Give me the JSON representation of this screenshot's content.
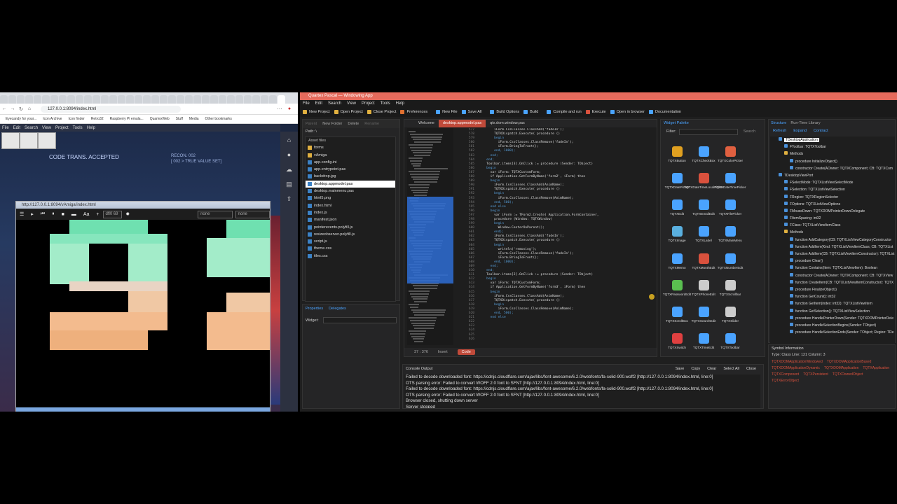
{
  "browser": {
    "tabs": [
      "",
      "",
      "",
      "",
      "",
      "",
      "",
      "",
      "",
      "",
      "",
      "",
      "",
      "",
      "",
      "",
      "",
      "",
      "",
      "",
      "",
      "",
      "",
      "",
      "",
      "",
      "",
      "",
      "",
      "",
      "",
      "",
      "",
      ""
    ],
    "url": "127.0.0.1:8094/index.html",
    "bookmarks": [
      "Eyecandy for your...",
      "Icon Archive",
      "Icon finder",
      "Retro32",
      "Raspberry Pi emula...",
      "QuartexWeb",
      "Stuff",
      "Media",
      "Other bookmarks"
    ],
    "app_menu": [
      "File",
      "Edit",
      "Search",
      "View",
      "Project",
      "Tools",
      "Help"
    ],
    "desktop_text": {
      "code_trans": "CODE TRANS. ACCEPTED",
      "recon": "RECON. 002",
      "true_value": "[ 002 > TRUE VALUE SET]"
    },
    "popup": {
      "title": "http://127.0.0.1:8094/vAmiga/index.html",
      "font_label": "Aa",
      "plus": "+",
      "dropdown_value": "dfl0 69",
      "input1_placeholder": "none",
      "input2_placeholder": "none"
    }
  },
  "ide": {
    "title": "Quartex Pascal — Windowing App",
    "menu": [
      "File",
      "Edit",
      "Search",
      "View",
      "Project",
      "Tools",
      "Help"
    ],
    "toolbar": [
      "New Project",
      "Open Project",
      "Close Project",
      "Preferences",
      "New File",
      "Save All",
      "Build Options",
      "Build",
      "Compile and run",
      "Execute",
      "Open in browser",
      "Documentation"
    ],
    "files_toolbar": [
      "Parent",
      "New Folder",
      "Delete",
      "Rename"
    ],
    "path": "Path: \\",
    "assets_header": "Asset files",
    "assets": [
      {
        "name": "forms",
        "type": "folder"
      },
      {
        "name": "vAmiga",
        "type": "folder"
      },
      {
        "name": "app.config.ini",
        "type": "file"
      },
      {
        "name": "app.entrypoint.pas",
        "type": "file"
      },
      {
        "name": "backdrop.jpg",
        "type": "file"
      },
      {
        "name": "desktop.appmodel.pas",
        "type": "file",
        "selected": true
      },
      {
        "name": "desktop.mainmenu.pas",
        "type": "file"
      },
      {
        "name": "html5.png",
        "type": "file"
      },
      {
        "name": "index.html",
        "type": "file"
      },
      {
        "name": "index.js",
        "type": "file"
      },
      {
        "name": "manifest.json",
        "type": "file"
      },
      {
        "name": "pointerevents.polyfill.js",
        "type": "file"
      },
      {
        "name": "resizeobserver.polyfill.js",
        "type": "file"
      },
      {
        "name": "script.js",
        "type": "file"
      },
      {
        "name": "theme.css",
        "type": "file"
      },
      {
        "name": "tiles.css",
        "type": "file"
      }
    ],
    "props_tabs": [
      "Properties",
      "Delegates"
    ],
    "widget_label": "Widget:",
    "editor_tabs": [
      "Welcome",
      "desktop.appmodel.pas",
      "qtx.dom.window.pas"
    ],
    "line_numbers": [
      "577",
      "578",
      "579",
      "580",
      "581",
      "582",
      "583",
      "584",
      "585",
      "586",
      "587",
      "588",
      "589",
      "590",
      "591",
      "592",
      "593",
      "594",
      "595",
      "596",
      "597",
      "598",
      "599",
      "600",
      "601",
      "602",
      "603",
      "604",
      "605",
      "606",
      "607",
      "608",
      "609",
      "610",
      "611",
      "612",
      "613",
      "614",
      "615",
      "616",
      "617",
      "618",
      "619",
      "620",
      "621",
      "622",
      "623",
      "624",
      "625",
      "626"
    ],
    "code_lines": [
      "        iForm.CssClasses.ClassAdd('fadeIn');",
      "        TQTXDispatch.Execute( procedure ()",
      "        begin",
      "          iForm.CssClasses.ClassRemove('fadeIn');",
      "          iForm.BringToFront();",
      "        end, 1000);",
      "",
      "      end;",
      "    end;",
      "",
      "    Toolbar.items[3].OnClick := procedure (Sender: TObject)",
      "    begin",
      "      var iForm: TQTXCustomForm;",
      "      if Application.GetFormByName('form2', iForm) then",
      "      begin",
      "        iForm.CssClasses.ClassAdd(AnimName);",
      "        TQTXDispatch.Execute( procedure ()",
      "        begin",
      "          iForm.CssClasses.ClassRemove(AnimName);",
      "        end, 500);",
      "      end else",
      "      begin",
      "        var iForm := TForm2.Create( Application.FormContainer,",
      "        procedure (Window: TQTXWindow)",
      "        begin",
      "          Window.CenterOnParent();",
      "        end);",
      "",
      "        iForm.CssClasses.ClassAdd('fadeIn');",
      "        TQTXDispatch.Execute( procedure ()",
      "        begin",
      "          writeln('removing');",
      "          iForm.CssClasses.ClassRemove('fadeIn');",
      "          iForm.BringToFront();",
      "        end, 1000);",
      "      end;",
      "    end;",
      "",
      "    Toolbar.items[2].OnClick := procedure (Sender: TObject)",
      "    begin",
      "      var iForm: TQTXCustomForm;",
      "      if Application.GetFormByName('form3', iForm) then",
      "      begin",
      "        iForm.CssClasses.ClassAdd(AnimName);",
      "        TQTXDispatch.Execute( procedure ()",
      "        begin",
      "          iForm.CssClasses.ClassRemove(AnimName);",
      "        end, 500);",
      "      end else"
    ],
    "editor_status": {
      "position": "37 : 376",
      "mode": "Insert",
      "code_label": "Code"
    },
    "palette": {
      "title": "Widget Palette",
      "filter_label": "Filter:",
      "search_label": "Search",
      "widgets": [
        "TQTXButton",
        "TQTXCheckBox",
        "TQTXColorPicker",
        "TQTXDatePicker",
        "TQTXDateTimeLocalPicker",
        "TQTXDateTimePicker",
        "TQTXEdit",
        "TQTXEmailEdit",
        "TQTXFilePicker",
        "TQTXImage",
        "TQTXLabel",
        "TQTXMainMenu",
        "TQTXMemo",
        "TQTXMonthEdit",
        "TQTXNumberEdit",
        "TQTXPasswordEdit",
        "TQTXPhoneEdit",
        "TQTXScrollbar",
        "TQTXScrollBox",
        "TQTXSearchEdit",
        "TQTXSlider",
        "TQTXSwitch",
        "TQTXTimeEdit",
        "TQTXToolbar"
      ]
    },
    "structure": {
      "tabs": [
        "Structure",
        "Run-Time Library"
      ],
      "tools": [
        "Refresh",
        "Expand",
        "Contract"
      ],
      "tree": [
        {
          "label": "TDesktopApplication",
          "level": 1,
          "color": "#4a90d9"
        },
        {
          "label": "FToolbar: TQTXToolbar",
          "level": 2,
          "color": "#4a90d9"
        },
        {
          "label": "Methods",
          "level": 2,
          "color": "#e0b040"
        },
        {
          "label": "procedure InitializeObject()",
          "level": 3,
          "color": "#4a90d9"
        },
        {
          "label": "constructor Create(AOwner: TQTXComponent; CB: TQTXCom",
          "level": 3,
          "color": "#4a90d9"
        },
        {
          "label": "TDesktopViewPort",
          "level": 1,
          "color": "#4a90d9"
        },
        {
          "label": "FSelectMode: TQTXListViewSelectMode",
          "level": 2,
          "color": "#4a90d9"
        },
        {
          "label": "FSelection: TQTXListViewSelection",
          "level": 2,
          "color": "#4a90d9"
        },
        {
          "label": "FRegion: TQTXRegionSelector",
          "level": 2,
          "color": "#4a90d9"
        },
        {
          "label": "FOptions: TQTXListViewOptions",
          "level": 2,
          "color": "#4a90d9"
        },
        {
          "label": "FMouseDown: TQTXDOMPointerDownDelegate",
          "level": 2,
          "color": "#4a90d9"
        },
        {
          "label": "FItemSpacing: int32",
          "level": 2,
          "color": "#4a90d9"
        },
        {
          "label": "FClass: TQTXListViewItemClass",
          "level": 2,
          "color": "#4a90d9"
        },
        {
          "label": "Methods",
          "level": 2,
          "color": "#e0b040"
        },
        {
          "label": "function AddCategory(CB: TQTXListViewCategoryConstructor",
          "level": 3,
          "color": "#4a90d9"
        },
        {
          "label": "function AddItem(Kind: TQTXListViewItemClass; CB: TQTXList",
          "level": 3,
          "color": "#4a90d9"
        },
        {
          "label": "function AddItem(CB: TQTXListViewItemConstructor): TQTXList",
          "level": 3,
          "color": "#4a90d9"
        },
        {
          "label": "procedure Clear()",
          "level": 3,
          "color": "#4a90d9"
        },
        {
          "label": "function Contains(Item: TQTXListViewItem): Boolean",
          "level": 3,
          "color": "#4a90d9"
        },
        {
          "label": "constructor Create(AOwner: TQTXComponent; CB: TQTXView",
          "level": 3,
          "color": "#4a90d9"
        },
        {
          "label": "function CreateItem(CB: TQTXListViewItemConstructor): TQTX",
          "level": 3,
          "color": "#4a90d9"
        },
        {
          "label": "procedure FinalizeObject()",
          "level": 3,
          "color": "#4a90d9"
        },
        {
          "label": "function GetCount(): int32",
          "level": 3,
          "color": "#4a90d9"
        },
        {
          "label": "function GetItem(index: int32): TQTXListViewItem",
          "level": 3,
          "color": "#4a90d9"
        },
        {
          "label": "function GetSelection(): TQTXListViewSelection",
          "level": 3,
          "color": "#4a90d9"
        },
        {
          "label": "procedure HandlePointerDown(Sender: TQTXDOMPointerDele",
          "level": 3,
          "color": "#4a90d9"
        },
        {
          "label": "procedure HandleSelectionBegins(Sender: TObject)",
          "level": 3,
          "color": "#4a90d9"
        },
        {
          "label": "procedure HandleSelectionEnds(Sender: TObject; Region: TRe",
          "level": 3,
          "color": "#4a90d9"
        }
      ]
    },
    "symbol_info": {
      "title": "Symbol Information",
      "details": "Type: Class   Line: 121   Column: 3",
      "relations": [
        "TQTXDOMApplicationWindowed",
        "TQTXDOMApplicationBased",
        "TQTXDOMApplicationDynamic",
        "TQTXDOMApplication",
        "TQTXApplication",
        "TQTXComponent",
        "TQTXPersistent",
        "TQTXOwnedObject",
        "TQTXErrorObject"
      ]
    },
    "console": {
      "title": "Console Output",
      "actions": [
        "Save",
        "Copy",
        "Clear",
        "Select All",
        "Close"
      ],
      "lines": [
        "Failed to decode downloaded font: https://cdnjs.cloudflare.com/ajax/libs/font-awesome/6.2.0/webfonts/fa-solid-900.woff2 [http://127.0.0.1:8094/index.html, line:0]",
        "OTS parsing error: Failed to convert WOFF 2.0 font to SFNT [http://127.0.0.1:8094/index.html, line:0]",
        "Failed to decode downloaded font: https://cdnjs.cloudflare.com/ajax/libs/font-awesome/6.2.0/webfonts/fa-solid-900.woff2 [http://127.0.0.1:8094/index.html, line:0]",
        "OTS parsing error: Failed to convert WOFF 2.0 font to SFNT [http://127.0.0.1:8094/index.html, line:0]",
        "Browser closed, shutting down server",
        "Server stopped"
      ]
    }
  },
  "colors": {
    "ide_title": "#e56a5c",
    "accent_blue": "#4aa3ff",
    "code_tab_active": "#c04a3a",
    "pixel_mint": "#7fe8b8",
    "pixel_peach": "#f0b888"
  }
}
